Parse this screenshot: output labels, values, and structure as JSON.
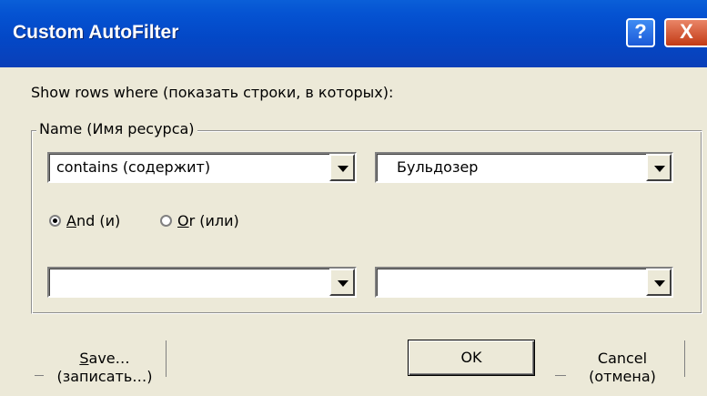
{
  "window": {
    "title": "Custom AutoFilter",
    "help_glyph": "?",
    "close_glyph": "X"
  },
  "prompt": "Show rows where  (показать строки, в которых):",
  "group": {
    "legend": "Name (Имя ресурса)",
    "condition1": {
      "operator": "contains (содержит)",
      "value": "Бульдозер"
    },
    "logic": {
      "and_prefix": "",
      "and_mnemonic": "A",
      "and_rest": "nd (и)",
      "or_mnemonic": "O",
      "or_rest": "r (или)",
      "selected": "and"
    },
    "condition2": {
      "operator": "",
      "value": ""
    }
  },
  "buttons": {
    "save_mnemonic": "S",
    "save_rest": "ave…",
    "save_sub": "(записать…)",
    "ok": "OK",
    "cancel": "Cancel",
    "cancel_sub": "(отмена)"
  },
  "colors": {
    "title_bar": "#0553d2",
    "dialog_bg": "#ece9d8",
    "close_button": "#c33a15"
  }
}
